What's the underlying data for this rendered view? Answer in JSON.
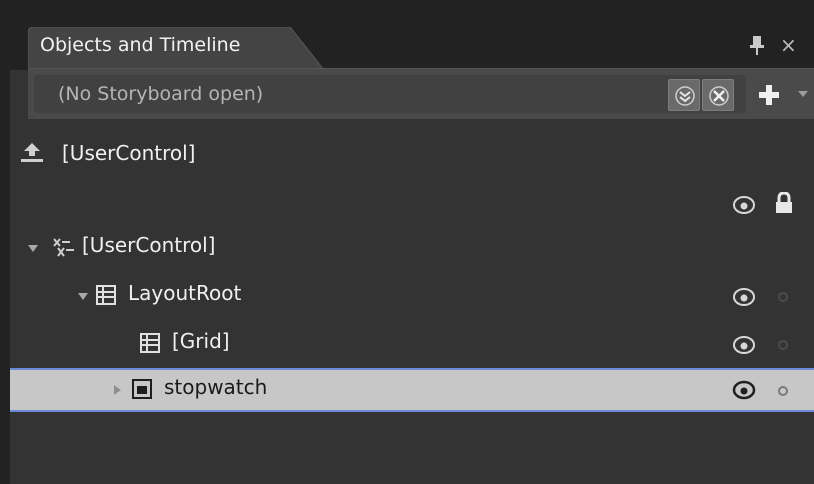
{
  "panel": {
    "title": "Objects and Timeline",
    "icons": [
      "pin-icon",
      "close-icon"
    ],
    "close_glyph": "×"
  },
  "storyboard": {
    "label": "(No Storyboard open)",
    "buttons": [
      "expand-all-icon",
      "close-storyboard-icon",
      "new-storyboard-icon",
      "dropdown-arrow-icon"
    ]
  },
  "tree": {
    "scope_row": {
      "label": "[UserControl]",
      "icon": "scope-up-icon"
    },
    "header_icons": [
      "visibility-eye-icon",
      "lock-icon"
    ],
    "items": [
      {
        "label": "[UserControl]",
        "icon": "usercontrol-icon",
        "expanded": true
      },
      {
        "label": "LayoutRoot",
        "icon": "grid-icon",
        "expanded": true
      },
      {
        "label": "[Grid]",
        "icon": "grid-icon"
      },
      {
        "label": "stopwatch",
        "icon": "element-icon",
        "expanded": false,
        "selected": true
      }
    ]
  },
  "colors": {
    "background": "#333333",
    "selection": "#c7c7c7",
    "selection_border": "#6b8bd8"
  }
}
